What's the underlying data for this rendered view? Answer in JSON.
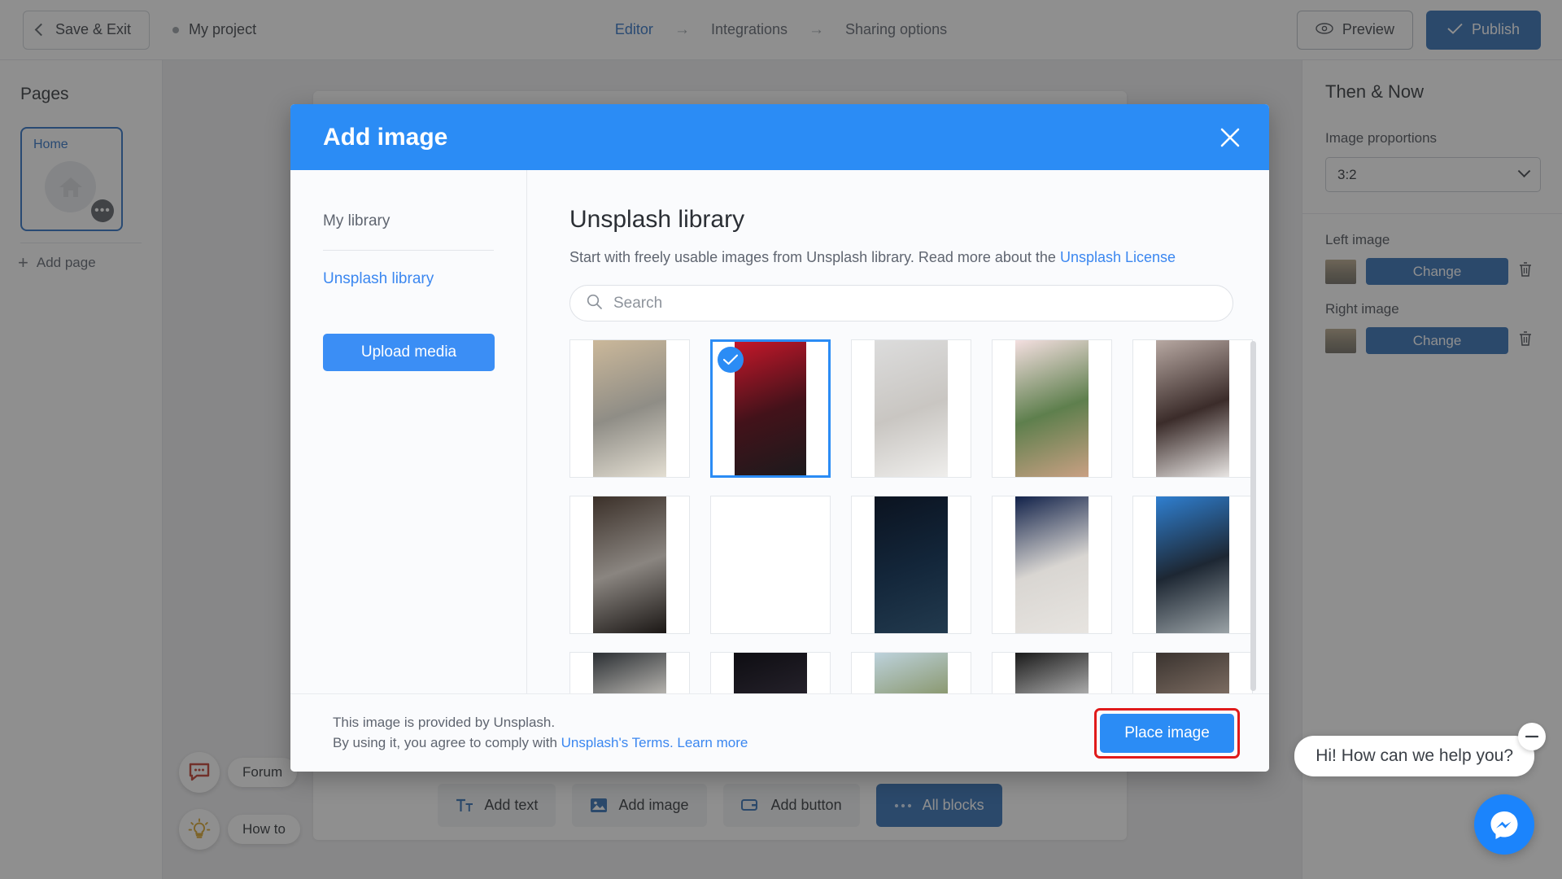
{
  "topbar": {
    "save_exit": "Save & Exit",
    "project_name": "My project",
    "steps": [
      {
        "label": "Editor",
        "active": true
      },
      {
        "label": "Integrations",
        "active": false
      },
      {
        "label": "Sharing options",
        "active": false
      }
    ],
    "arrow_glyph": "→",
    "preview": "Preview",
    "publish": "Publish"
  },
  "pages": {
    "title": "Pages",
    "page_label": "Home",
    "more_glyph": "•••",
    "add_page": "Add page"
  },
  "canvas": {
    "blocks": [
      {
        "label": "Add text",
        "icon": "text-icon",
        "primary": false
      },
      {
        "label": "Add image",
        "icon": "image-icon",
        "primary": false
      },
      {
        "label": "Add button",
        "icon": "button-icon",
        "primary": false
      },
      {
        "label": "All blocks",
        "icon": "ellipsis-icon",
        "primary": true
      }
    ],
    "help": [
      {
        "label": "Forum",
        "icon": "chat-icon"
      },
      {
        "label": "How to",
        "icon": "lightbulb-icon"
      }
    ]
  },
  "right_panel": {
    "title": "Then & Now",
    "proportions_label": "Image proportions",
    "proportions_value": "3:2",
    "left_image_label": "Left image",
    "right_image_label": "Right image",
    "change_label": "Change"
  },
  "modal": {
    "title": "Add image",
    "sidebar": {
      "my_library": "My library",
      "unsplash_library": "Unsplash library",
      "upload_media": "Upload media"
    },
    "main": {
      "heading": "Unsplash library",
      "subtitle_pre": "Start with freely usable images from Unsplash library. Read more about the ",
      "subtitle_link": "Unsplash License",
      "search_placeholder": "Search",
      "search_value": ""
    },
    "footer": {
      "line1": "This image is provided by Unsplash.",
      "line2_pre": "By using it, you agree to comply with ",
      "line2_link": "Unsplash's Terms. Learn more",
      "place_image": "Place image"
    },
    "grid": [
      {
        "id": 1,
        "alt": "laptop-notebook-desk-flatlay",
        "selected": false,
        "c1": "#cbb89a",
        "c2": "#8f8d86",
        "c3": "#e3ded2"
      },
      {
        "id": 2,
        "alt": "woman-in-red-light-portrait",
        "selected": true,
        "c1": "#c4172a",
        "c2": "#43121a",
        "c3": "#1c1a1c"
      },
      {
        "id": 3,
        "alt": "woman-in-white-robe",
        "selected": false,
        "c1": "#dcdcdc",
        "c2": "#c9c6c2",
        "c3": "#efeeec"
      },
      {
        "id": 4,
        "alt": "hand-touching-rose-plant",
        "selected": false,
        "c1": "#f4dfe0",
        "c2": "#5e7f4d",
        "c3": "#c9a083"
      },
      {
        "id": 5,
        "alt": "woman-white-shirt-portrait",
        "selected": false,
        "c1": "#b7a8a2",
        "c2": "#3b2c2a",
        "c3": "#e8e5e3"
      },
      {
        "id": 6,
        "alt": "man-working-on-laptop-dark",
        "selected": false,
        "c1": "#3b3029",
        "c2": "#8a8580",
        "c3": "#1b1715"
      },
      {
        "id": 7,
        "alt": "sunlit-interior-workspace",
        "selected": false,
        "c1": "#e5dccb",
        "c2": "#b9a versus88",
        "c3": "#9c8e76"
      },
      {
        "id": 8,
        "alt": "night-sky-star-trails-lake",
        "selected": false,
        "c1": "#0b1320",
        "c2": "#13263a",
        "c3": "#223a4e"
      },
      {
        "id": 9,
        "alt": "hand-on-shoulder-closeup",
        "selected": false,
        "c1": "#12224a",
        "c2": "#d9d6d2",
        "c3": "#e7e4e0"
      },
      {
        "id": 10,
        "alt": "skateboarder-standing-outdoors",
        "selected": false,
        "c1": "#2f7fd0",
        "c2": "#1d2733",
        "c3": "#9aa2a6"
      },
      {
        "id": 11,
        "alt": "designer-at-monitor-desk",
        "selected": false,
        "c1": "#2b2f33",
        "c2": "#d8d4cd",
        "c3": "#6d7b5a"
      },
      {
        "id": 12,
        "alt": "milky-way-over-silhouette",
        "selected": false,
        "c1": "#0e0d12",
        "c2": "#2a2630",
        "c3": "#070608"
      },
      {
        "id": 13,
        "alt": "empty-road-through-trees",
        "selected": false,
        "c1": "#bdd2dc",
        "c2": "#7e8a55",
        "c3": "#55606a"
      },
      {
        "id": 14,
        "alt": "ballet-dancers-motion-blur",
        "selected": false,
        "c1": "#1a1a1a",
        "c2": "#cfcfcf",
        "c3": "#0d0d0d"
      },
      {
        "id": 15,
        "alt": "woman-behind-rainy-glass",
        "selected": false,
        "c1": "#3a332f",
        "c2": "#8c7a6e",
        "c3": "#1d1917"
      }
    ]
  },
  "chat": {
    "message": "Hi! How can we help you?",
    "minimize_glyph": "—"
  }
}
